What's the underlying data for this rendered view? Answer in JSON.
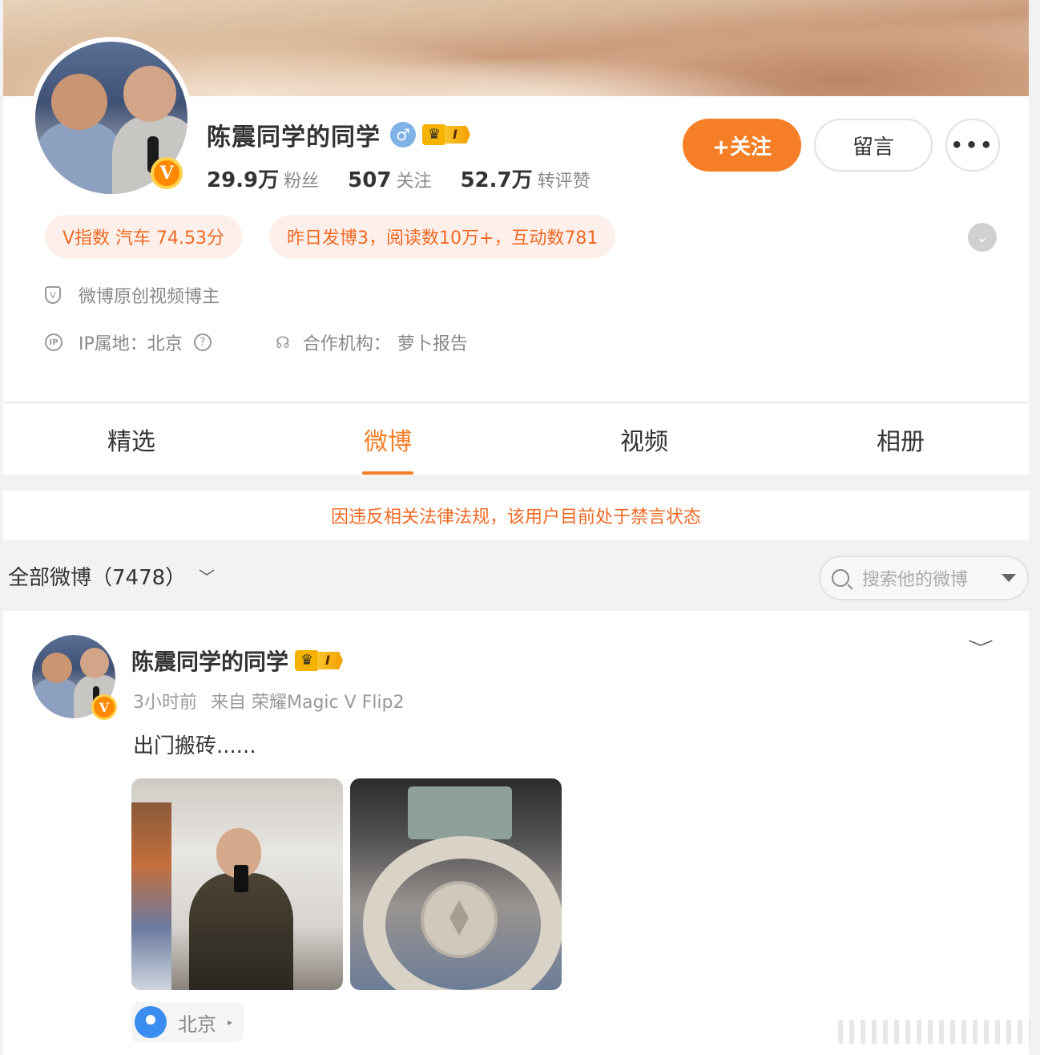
{
  "profile": {
    "name": "陈震同学的同学",
    "gender_symbol": "♂",
    "crown_level": "I",
    "verified_badge": "V",
    "stats": [
      {
        "num": "29.9万",
        "label": "粉丝"
      },
      {
        "num": "507",
        "label": "关注"
      },
      {
        "num": "52.7万",
        "label": "转评赞"
      }
    ],
    "buttons": {
      "follow": "+关注",
      "message": "留言",
      "more": "•••"
    },
    "pills": {
      "vindex": "V指数 汽车 74.53分",
      "daily": "昨日发博3，阅读数10万+，互动数781"
    },
    "expand_icon": "⌄",
    "verification": "微博原创视频博主",
    "ip_label": "IP属地：北京",
    "ip_icon_text": "IP",
    "partner_label": "合作机构：",
    "partner_value": "萝卜报告"
  },
  "tabs": [
    {
      "label": "精选",
      "active": false
    },
    {
      "label": "微博",
      "active": true
    },
    {
      "label": "视频",
      "active": false
    },
    {
      "label": "相册",
      "active": false
    }
  ],
  "notice": "因违反相关法律法规，该用户目前处于禁言状态",
  "feed": {
    "title": "全部微博（7478）",
    "chevron": "﹀",
    "search_placeholder": "搜索他的微博"
  },
  "post": {
    "author": "陈震同学的同学",
    "crown_level": "I",
    "verified_badge": "V",
    "time": "3小时前",
    "source": "来自 荣耀Magic V Flip2",
    "text": "出门搬砖......",
    "toggle": "﹀",
    "location": "北京",
    "location_arrow": "▸"
  },
  "colors": {
    "accent": "#f57e27",
    "notice": "#f06a26",
    "pill_bg": "#fdf0ea"
  }
}
